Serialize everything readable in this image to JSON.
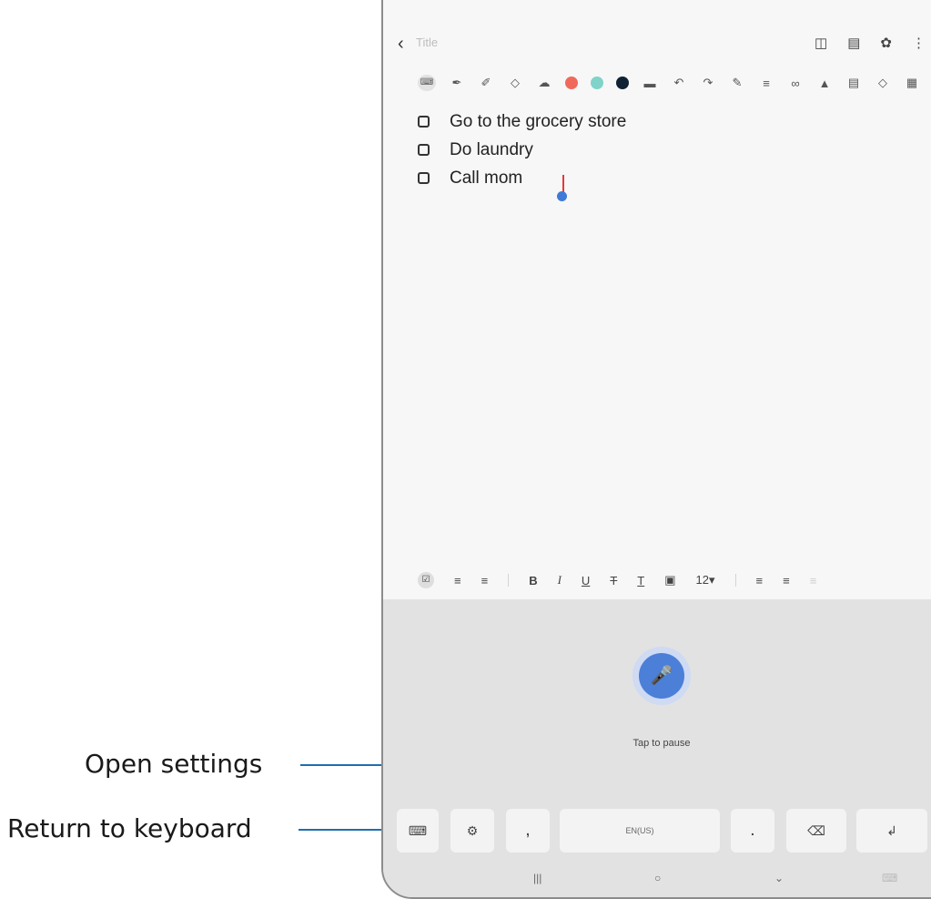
{
  "callouts": {
    "open_settings": "Open settings",
    "return_to_keyboard": "Return to keyboard"
  },
  "note": {
    "title_placeholder": "Title",
    "checklist": [
      "Go to the grocery store",
      "Do laundry",
      "Call mom"
    ]
  },
  "toolbar": {
    "pen_colors": [
      "#ef6a5b",
      "#7fd3c9",
      "#0f2233"
    ]
  },
  "format_bar": {
    "bold": "B",
    "italic": "I",
    "underline": "U",
    "strike": "T",
    "text_color": "T",
    "font_size": "12▾"
  },
  "voice": {
    "status": "Tap to pause"
  },
  "keyboard": {
    "comma": ",",
    "language": "EN(US)",
    "period": "."
  },
  "accent_color": "#4b7fd8"
}
